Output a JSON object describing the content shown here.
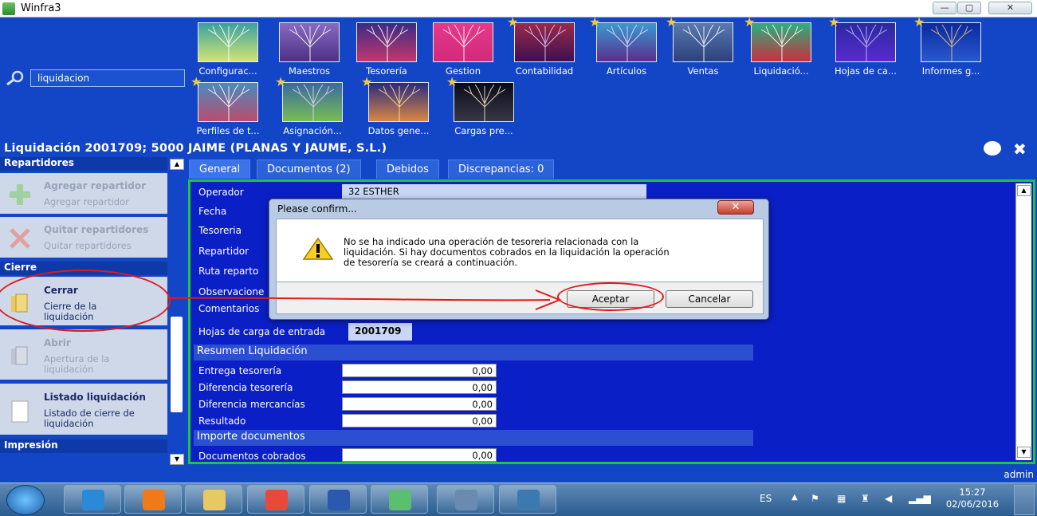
{
  "window": {
    "title": "Winfra3",
    "min": "—",
    "max": "▢",
    "close": "✕"
  },
  "search": {
    "value": "liquidacion"
  },
  "tiles_row1": [
    {
      "label": "Configurac...",
      "starred": false,
      "colors": [
        "#3aa0a0",
        "#d8e870"
      ],
      "tree": "#ffffff"
    },
    {
      "label": "Maestros",
      "starred": false,
      "colors": [
        "#8a6ac0",
        "#4a2e82"
      ],
      "tree": "#ffffff"
    },
    {
      "label": "Tesorería",
      "starred": false,
      "colors": [
        "#3b2b86",
        "#c9386a"
      ],
      "tree": "#ffffff"
    },
    {
      "label": "Gestion",
      "starred": false,
      "colors": [
        "#e8388a",
        "#d02a7a"
      ],
      "tree": "#ffffff"
    },
    {
      "label": "Contabilidad",
      "starred": true,
      "colors": [
        "#9a2a4a",
        "#3a1050"
      ],
      "tree": "#e0c8ff"
    },
    {
      "label": "Artículos",
      "starred": true,
      "colors": [
        "#3a9ad0",
        "#5c2a8a"
      ],
      "tree": "#e0e0ff"
    },
    {
      "label": "Ventas",
      "starred": true,
      "colors": [
        "#5a7ab0",
        "#2a3e7a"
      ],
      "tree": "#ffffff"
    },
    {
      "label": "Liquidació...",
      "starred": true,
      "colors": [
        "#2ab080",
        "#d02a3a"
      ],
      "tree": "#ffffff"
    },
    {
      "label": "Hojas de ca...",
      "starred": true,
      "colors": [
        "#2a2aa0",
        "#5a2ad0"
      ],
      "tree": "#c8b8ff"
    },
    {
      "label": "Informes g...",
      "starred": true,
      "colors": [
        "#0a2aa0",
        "#2a5ad0"
      ],
      "tree": "#f0c080"
    }
  ],
  "tiles_row2": [
    {
      "label": "Perfiles de t...",
      "starred": true,
      "colors": [
        "#4a8ac0",
        "#c04a6a"
      ],
      "tree": "#ffffff"
    },
    {
      "label": "Asignación...",
      "starred": true,
      "colors": [
        "#3a6aa0",
        "#7ac050"
      ],
      "tree": "#e0d0ff"
    },
    {
      "label": "Datos gene...",
      "starred": true,
      "colors": [
        "#2a2a80",
        "#e08a40"
      ],
      "tree": "#ffe0a0"
    },
    {
      "label": "Cargas pre...",
      "starred": true,
      "colors": [
        "#0a0a1a",
        "#3a3a4a"
      ],
      "tree": "#f8e8c0"
    }
  ],
  "record": {
    "title": "Liquidación 2001709; 5000 JAIME (PLANAS Y JAUME, S.L.)"
  },
  "sidebar": {
    "group_repartidores": "Repartidores",
    "add_title": "Agregar repartidor",
    "add_sub": "Agregar repartidor",
    "remove_title": "Quitar repartidores",
    "remove_sub": "Quitar repartidores",
    "group_cierre": "Cierre",
    "close_title": "Cerrar",
    "close_sub_1": "Cierre de la",
    "close_sub_2": "liquidación",
    "open_title": "Abrir",
    "open_sub_1": "Apertura de la",
    "open_sub_2": "liquidación",
    "list_title": "Listado liquidación",
    "list_sub_1": "Listado de cierre de",
    "list_sub_2": "liquidación",
    "group_impresion": "Impresión"
  },
  "tabs": [
    "General",
    "Documentos (2)",
    "Debidos",
    "Discrepancias: 0"
  ],
  "form": {
    "operador_label": "Operador",
    "operador_value": "32 ESTHER",
    "fecha_label": "Fecha",
    "tesoreria_label": "Tesoreria",
    "repartidor_label": "Repartidor",
    "ruta_label": "Ruta reparto",
    "observaciones_label": "Observacione",
    "comentarios_label": "Comentarios",
    "hojas_label": "Hojas de carga de entrada",
    "hojas_value": "2001709",
    "resumen_head": "Resumen Liquidación",
    "entrega_label": "Entrega tesorería",
    "entrega_value": "0,00",
    "dif_tes_label": "Diferencia tesorería",
    "dif_tes_value": "0,00",
    "dif_merc_label": "Diferencia mercancías",
    "dif_merc_value": "0,00",
    "resultado_label": "Resultado",
    "resultado_value": "0,00",
    "importe_head": "Importe documentos",
    "docs_label": "Documentos cobrados",
    "docs_value": "0,00"
  },
  "dialog": {
    "title": "Please confirm...",
    "close": "✕",
    "message_1": "No se ha indicado una operación de tesoreria relacionada con la",
    "message_2": "liquidación. Si hay documentos cobrados en la liquidación la operación",
    "message_3": "de tesorería se creará a continuación.",
    "accept": "Aceptar",
    "cancel": "Cancelar"
  },
  "status": {
    "user": "admin"
  },
  "taskbar": {
    "lang": "ES",
    "time": "15:27",
    "date": "02/06/2016",
    "apps": [
      {
        "name": "ie",
        "color": "#2a8ad8"
      },
      {
        "name": "media",
        "color": "#f07a1a"
      },
      {
        "name": "explorer",
        "color": "#e8c860"
      },
      {
        "name": "chrome",
        "color": "#e84a3a"
      },
      {
        "name": "word",
        "color": "#2a5ab0"
      },
      {
        "name": "winfra",
        "color": "#5ac070"
      },
      {
        "name": "anydesk",
        "color": "#6a8ab0"
      },
      {
        "name": "photos",
        "color": "#3a7ab0"
      }
    ]
  },
  "colors": {
    "accent": "#1346c6",
    "panel": "#0b1fc7",
    "panel_border": "#1cc640",
    "annotation": "#e01a1a"
  }
}
